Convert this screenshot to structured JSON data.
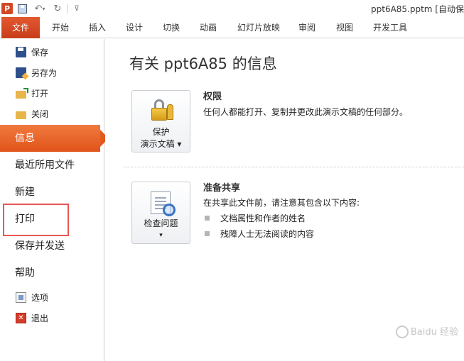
{
  "titlebar": {
    "app_logo": "P",
    "qat_icons": [
      "save-icon",
      "undo-icon",
      "redo-icon",
      "customize-icon"
    ],
    "undo_glyph": "↶",
    "undo_drop": "▾",
    "redo_glyph": "↻",
    "customize_glyph": "⊽",
    "doc_title": "ppt6A85.pptm [自动保"
  },
  "ribbon": {
    "tabs": [
      {
        "label": "文件",
        "active": true
      },
      {
        "label": "开始"
      },
      {
        "label": "插入"
      },
      {
        "label": "设计"
      },
      {
        "label": "切换"
      },
      {
        "label": "动画"
      },
      {
        "label": "幻灯片放映"
      },
      {
        "label": "审阅"
      },
      {
        "label": "视图"
      },
      {
        "label": "开发工具"
      }
    ]
  },
  "nav": {
    "commands": [
      {
        "label": "保存",
        "icon": "save-icon"
      },
      {
        "label": "另存为",
        "icon": "save-as-icon"
      },
      {
        "label": "打开",
        "icon": "open-folder-icon"
      },
      {
        "label": "关闭",
        "icon": "close-folder-icon"
      }
    ],
    "tabs": [
      {
        "label": "信息",
        "active": true
      },
      {
        "label": "最近所用文件"
      },
      {
        "label": "新建"
      },
      {
        "label": "打印",
        "highlighted": true
      },
      {
        "label": "保存并发送"
      },
      {
        "label": "帮助"
      }
    ],
    "footer": [
      {
        "label": "选项",
        "icon": "options-icon"
      },
      {
        "label": "退出",
        "icon": "exit-icon",
        "glyph": "✕"
      }
    ],
    "highlight_color": "#e85656"
  },
  "main": {
    "title": "有关 ppt6A85 的信息",
    "permissions": {
      "button_line1": "保护",
      "button_line2": "演示文稿 ▾",
      "title": "权限",
      "desc": "任何人都能打开、复制并更改此演示文稿的任何部分。"
    },
    "prepare": {
      "button_line1": "检查问题",
      "button_line2": "▾",
      "title": "准备共享",
      "desc": "在共享此文件前，请注意其包含以下内容:",
      "bullets": [
        "文档属性和作者的姓名",
        "残障人士无法阅读的内容"
      ]
    }
  },
  "watermark": "Baidu 经验",
  "colors": {
    "accent": "#d8441f",
    "active_nav": "#e9662b"
  }
}
